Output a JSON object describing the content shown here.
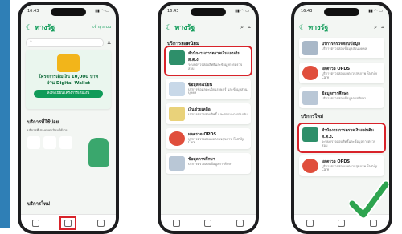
{
  "phone1": {
    "time": "16:43",
    "app_name": "ทางรัฐ",
    "header_link": "เข้าสู่ระบบ",
    "banner_title": "โครงการเติมเงิน 10,000 บาท",
    "banner_subtitle": "ผ่าน Digital Wallet",
    "banner_button": "ลงทะเบียนโครงการเติมเงิน",
    "section_recommended": "บริการที่ใช้บ่อย",
    "section_recommended_desc": "บริการที่ประชาชนนิยมใช้งาน",
    "section_new": "บริการใหม่"
  },
  "phone2": {
    "time": "16:43",
    "app_name": "ทางรัฐ",
    "section_title": "บริการยอดนิยม",
    "items": [
      {
        "title": "สำนักงานการตรวจเงินแผ่นดิน ส.ต.ง.",
        "desc": "ระบบตรวจสอบสิทธิ์และข้อมูลการตรวจสอบ"
      },
      {
        "title": "ข้อมูลทะเบียน",
        "desc": "บริการข้อมูลทะเบียนราษฎร์ และข้อมูลส่วนบุคคล"
      },
      {
        "title": "เงินช่วยเหลือ",
        "desc": "บริการตรวจสอบสิทธิ์ และสถานะการรับเงิน"
      },
      {
        "title": "ผลตรวจ OPDS",
        "desc": "บริการตรวจสอบผลตรวจสุขภาพ Family Care"
      },
      {
        "title": "ข้อมูลการศึกษา",
        "desc": "บริการตรวจสอบข้อมูลการศึกษา"
      }
    ]
  },
  "phone3": {
    "time": "16:43",
    "app_name": "ทางรัฐ",
    "section_new": "บริการใหม่",
    "items": [
      {
        "title": "บริการตรวจสอบข้อมูล",
        "desc": "บริการตรวจสอบข้อมูลส่วนบุคคล"
      },
      {
        "title": "ผลตรวจ OPDS",
        "desc": "บริการตรวจสอบผลตรวจสุขภาพ Family Care"
      },
      {
        "title": "ข้อมูลการศึกษา",
        "desc": "บริการตรวจสอบข้อมูลการศึกษา"
      },
      {
        "title": "สำนักงานการตรวจเงินแผ่นดิน ส.ต.ง.",
        "desc": "ระบบตรวจสอบสิทธิ์และข้อมูลการตรวจสอบ"
      },
      {
        "title": "ผลตรวจ OPDS",
        "desc": "บริการตรวจสอบผลตรวจสุขภาพ Family Care"
      }
    ]
  }
}
